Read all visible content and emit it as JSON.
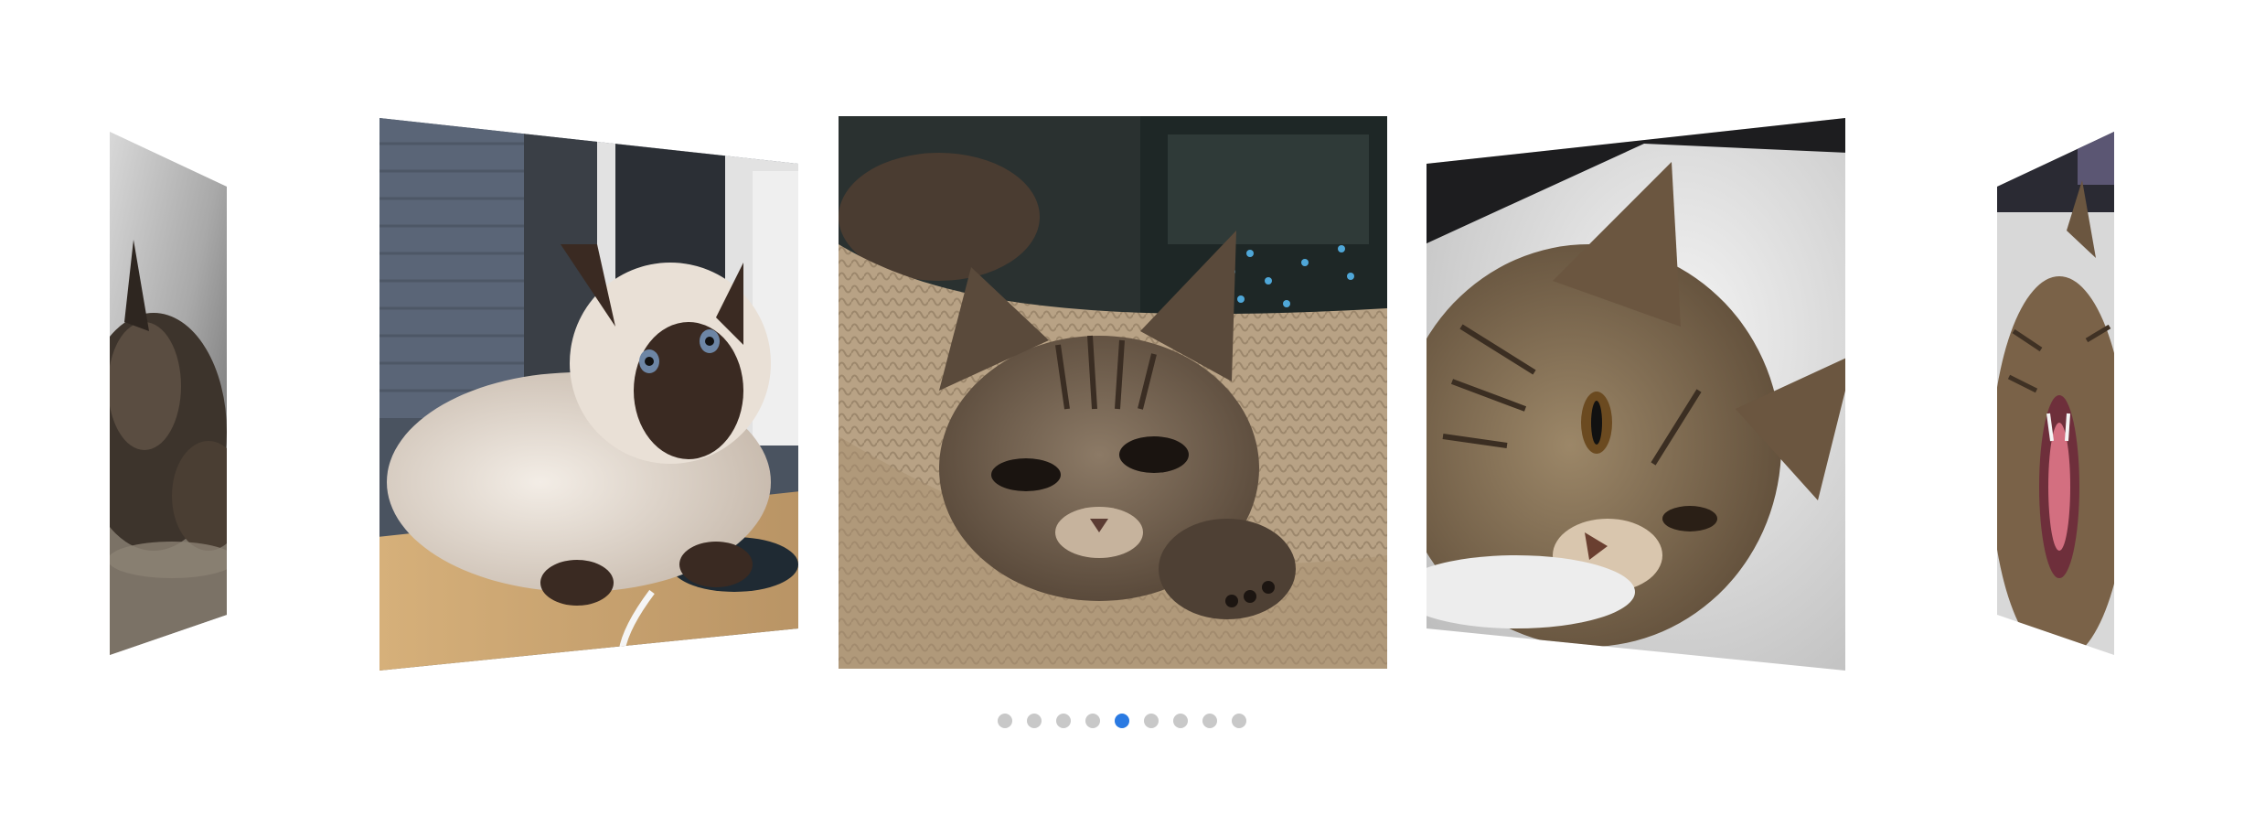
{
  "carousel": {
    "slides": [
      {
        "subject": "tabby-cat-sleeping"
      },
      {
        "subject": "ragdoll-cat-on-desk"
      },
      {
        "subject": "tabby-cat-on-knit-blanket"
      },
      {
        "subject": "tabby-cat-lying-on-fur"
      },
      {
        "subject": "tabby-cat-yawning"
      }
    ],
    "active_slide": "tabby-cat-on-knit-blanket"
  },
  "pagination": {
    "total": 9,
    "active_index": 4
  },
  "colors": {
    "accent": "#2a7ae2",
    "inactive_dot": "#c8c8c8",
    "background": "#ffffff"
  }
}
